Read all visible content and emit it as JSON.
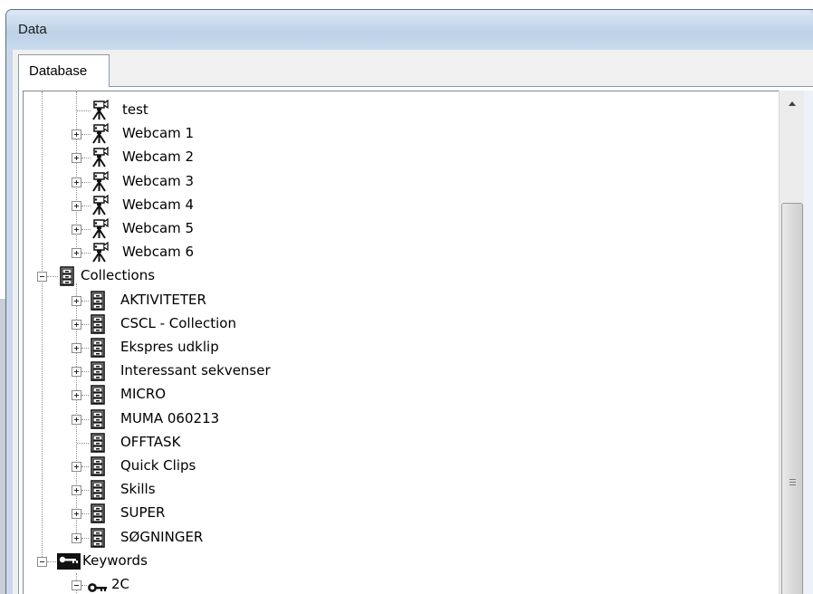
{
  "window": {
    "title": "Data"
  },
  "tabs": [
    {
      "label": "Database",
      "selected": true
    }
  ],
  "tree": {
    "webcams": [
      "test",
      "Webcam 1",
      "Webcam 2",
      "Webcam 3",
      "Webcam 4",
      "Webcam 5",
      "Webcam 6"
    ],
    "collections_label": "Collections",
    "collections": [
      "AKTIVITETER",
      "CSCL - Collection",
      "Ekspres udklip",
      "Interessant sekvenser",
      "MICRO",
      "MUMA 060213",
      "OFFTASK",
      "Quick Clips",
      "Skills",
      "SUPER",
      "SØGNINGER"
    ],
    "keywords_label": "Keywords",
    "keywords": [
      "2C"
    ]
  },
  "icons": {
    "webcam": "video-camera-icon",
    "collection": "filing-cabinet-icon",
    "keywords": "keys-icon",
    "keyword": "key-icon"
  },
  "scrollbar": {
    "position_fraction": 0.22
  }
}
